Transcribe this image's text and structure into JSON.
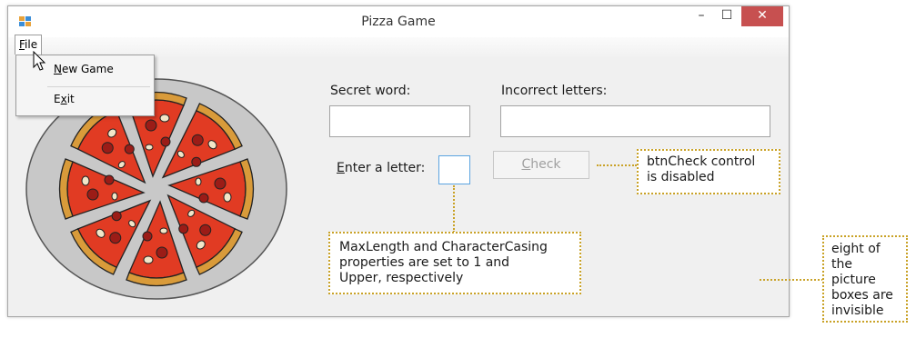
{
  "window": {
    "title": "Pizza Game",
    "minimize_glyph": "–",
    "maximize_glyph": "☐",
    "close_glyph": "✕"
  },
  "menu": {
    "file_label": "File",
    "file_accel": "F",
    "file_rest": "ile",
    "items": [
      {
        "label": "New Game",
        "accel": "N",
        "rest": "ew Game"
      },
      {
        "label": "Exit",
        "pre": "E",
        "accel": "x",
        "rest": "it"
      }
    ]
  },
  "form": {
    "secret_word_label": "Secret word:",
    "incorrect_letters_label": "Incorrect letters:",
    "enter_letter_label": "Enter a letter:",
    "enter_letter_accel": "E",
    "enter_letter_rest": "nter a letter:",
    "secret_word_value": "",
    "incorrect_letters_value": "",
    "letter_value": "",
    "check_label": "Check",
    "check_accel": "C",
    "check_rest": "heck",
    "check_disabled": true
  },
  "pizza": {
    "slices": 8,
    "icon": "pizza-image"
  },
  "callouts": {
    "check_disabled_line1": "btnCheck control",
    "check_disabled_line2": "is disabled",
    "letterbox_line1": "MaxLength and CharacterCasing",
    "letterbox_line2": "properties are set to 1 and",
    "letterbox_line3": "Upper, respectively",
    "invisible_line1": "eight of",
    "invisible_line2": "the picture",
    "invisible_line3": "boxes are",
    "invisible_line4": "invisible"
  },
  "colors": {
    "callout_border": "#c9a227",
    "close_button": "#c75050",
    "window_bg": "#f0f0f0"
  }
}
